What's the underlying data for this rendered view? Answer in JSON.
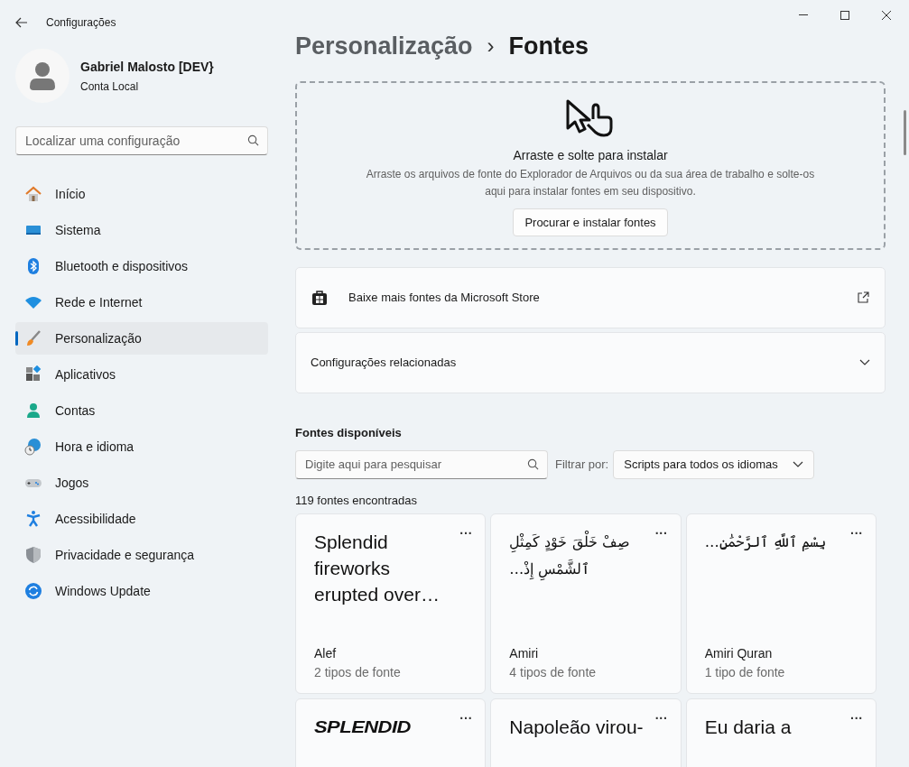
{
  "window": {
    "title": "Configurações"
  },
  "user": {
    "name": "Gabriel Malosto [DEV}",
    "account": "Conta Local"
  },
  "sidebar": {
    "search": {
      "placeholder": "Localizar uma configuração"
    },
    "items": [
      {
        "label": "Início",
        "selected": false
      },
      {
        "label": "Sistema",
        "selected": false
      },
      {
        "label": "Bluetooth e dispositivos",
        "selected": false
      },
      {
        "label": "Rede e Internet",
        "selected": false
      },
      {
        "label": "Personalização",
        "selected": true
      },
      {
        "label": "Aplicativos",
        "selected": false
      },
      {
        "label": "Contas",
        "selected": false
      },
      {
        "label": "Hora e idioma",
        "selected": false
      },
      {
        "label": "Jogos",
        "selected": false
      },
      {
        "label": "Acessibilidade",
        "selected": false
      },
      {
        "label": "Privacidade e segurança",
        "selected": false
      },
      {
        "label": "Windows Update",
        "selected": false
      }
    ]
  },
  "breadcrumb": {
    "parent": "Personalização",
    "separator": "›",
    "current": "Fontes"
  },
  "drop_zone": {
    "title": "Arraste e solte para instalar",
    "description": "Arraste os arquivos de fonte do Explorador de Arquivos ou da sua área de trabalho e solte-os aqui para instalar fontes em seu dispositivo.",
    "button": "Procurar e instalar fontes"
  },
  "store_link": {
    "label": "Baixe mais fontes da Microsoft Store"
  },
  "related": {
    "label": "Configurações relacionadas",
    "expanded": false
  },
  "fonts": {
    "heading": "Fontes disponíveis",
    "search": {
      "placeholder": "Digite aqui para pesquisar"
    },
    "filter_label": "Filtrar por:",
    "filter_value": "Scripts para todos os idiomas",
    "count": "119 fontes encontradas",
    "cards": [
      {
        "kind": "latin",
        "preview": "Splendid fireworks erupted over…",
        "name": "Alef",
        "styles": "2 tipos de fonte",
        "menu": "···"
      },
      {
        "kind": "arabic",
        "preview": "صِفْ خَلْقَ خَوْدٍ كَمِثْلِ ٱلشَّمْسِ إِذْ…",
        "name": "Amiri",
        "styles": "4 tipos de fonte",
        "menu": "···"
      },
      {
        "kind": "arabic",
        "preview": "بِسْمِ ٱللَّهِ ٱلرَّحْمَٰنِ…",
        "name": "Amiri Quran",
        "styles": "1 tipo de fonte",
        "menu": "···"
      },
      {
        "kind": "display",
        "preview": "SPLENDID",
        "menu": "···"
      },
      {
        "kind": "latin",
        "preview": "Napoleão virou-",
        "menu": "···"
      },
      {
        "kind": "latin",
        "preview": "Eu daria a",
        "menu": "···"
      }
    ]
  }
}
